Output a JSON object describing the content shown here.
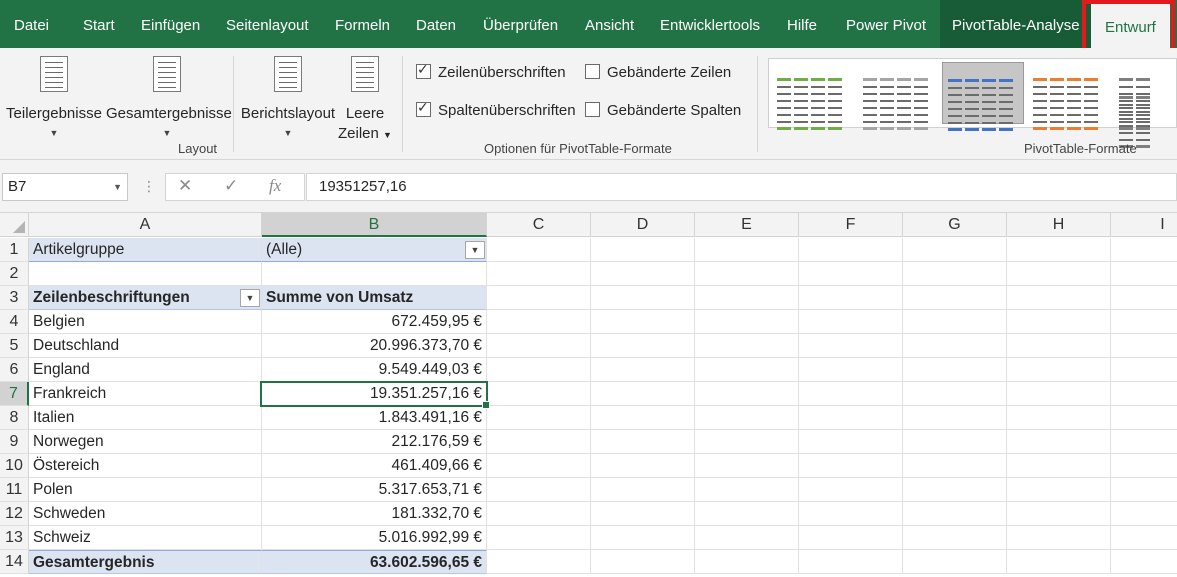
{
  "menu": {
    "items": [
      "Datei",
      "Start",
      "Einfügen",
      "Seitenlayout",
      "Formeln",
      "Daten",
      "Überprüfen",
      "Ansicht",
      "Entwicklertools",
      "Hilfe",
      "Power Pivot"
    ],
    "context_tab": "PivotTable-Analyse",
    "active_tab": "Entwurf",
    "highlight_color": "#e3191b"
  },
  "ribbon": {
    "layout": {
      "subtotals": "Teilergebnisse",
      "grand_totals": "Gesamtergebnisse",
      "report_layout": "Berichtslayout",
      "blank_rows_1": "Leere",
      "blank_rows_2": "Zeilen",
      "group_label": "Layout"
    },
    "style_options": {
      "row_headers": {
        "label": "Zeilenüberschriften",
        "checked": true
      },
      "col_headers": {
        "label": "Spaltenüberschriften",
        "checked": true
      },
      "banded_rows": {
        "label": "Gebänderte Zeilen",
        "checked": false
      },
      "banded_cols": {
        "label": "Gebänderte Spalten",
        "checked": false
      },
      "group_label": "Optionen für PivotTable-Formate"
    },
    "styles": {
      "group_label": "PivotTable-Formate",
      "swatch_colors": [
        "#70ad47",
        "#a5a5a5",
        "#4472c4",
        "#ed7d31",
        "#7f7f7f"
      ]
    }
  },
  "formula_bar": {
    "name_box": "B7",
    "cancel_icon": "✕",
    "enter_icon": "✓",
    "fx_label": "fx",
    "formula": "19351257,16"
  },
  "grid": {
    "columns": [
      "A",
      "B",
      "C",
      "D",
      "E",
      "F",
      "G",
      "H",
      "I"
    ],
    "rows": [
      "1",
      "2",
      "3",
      "4",
      "5",
      "6",
      "7",
      "8",
      "9",
      "10",
      "11",
      "12",
      "13",
      "14"
    ],
    "filter_label": "Artikelgruppe",
    "filter_value": "(Alle)",
    "header_rows": "Zeilenbeschriftungen",
    "header_values": "Summe von Umsatz",
    "data": [
      {
        "country": "Belgien",
        "value": "672.459,95 €"
      },
      {
        "country": "Deutschland",
        "value": "20.996.373,70 €"
      },
      {
        "country": "England",
        "value": "9.549.449,03 €"
      },
      {
        "country": "Frankreich",
        "value": "19.351.257,16 €"
      },
      {
        "country": "Italien",
        "value": "1.843.491,16 €"
      },
      {
        "country": "Norwegen",
        "value": "212.176,59 €"
      },
      {
        "country": "Östereich",
        "value": "461.409,66 €"
      },
      {
        "country": "Polen",
        "value": "5.317.653,71 €"
      },
      {
        "country": "Schweden",
        "value": "181.332,70 €"
      },
      {
        "country": "Schweiz",
        "value": "5.016.992,99 €"
      }
    ],
    "total_label": "Gesamtergebnis",
    "total_value": "63.602.596,65 €"
  }
}
